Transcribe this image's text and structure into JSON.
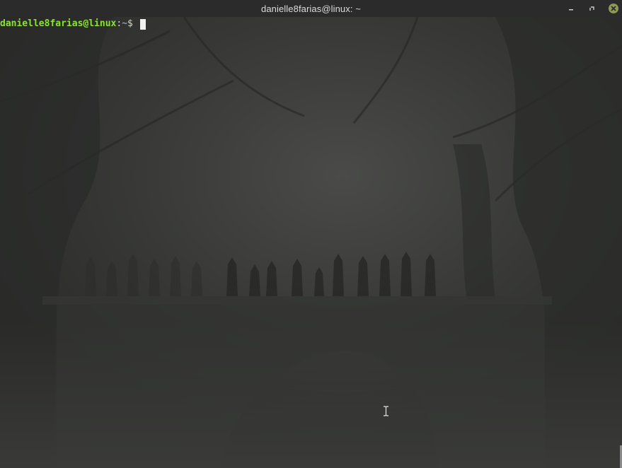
{
  "window": {
    "title": "danielle8farias@linux: ~"
  },
  "controls": {
    "minimize_icon": "minimize-icon",
    "maximize_icon": "maximize-icon",
    "close_icon": "close-icon",
    "close_color": "#8f9a57"
  },
  "terminal": {
    "prompt_user_host": "danielle8farias@linux",
    "prompt_colon": ":",
    "prompt_path": "~",
    "prompt_symbol": "$ ",
    "user_color": "#8ae234",
    "path_color": "#8f9ab0",
    "background_color": "#2f302e"
  }
}
